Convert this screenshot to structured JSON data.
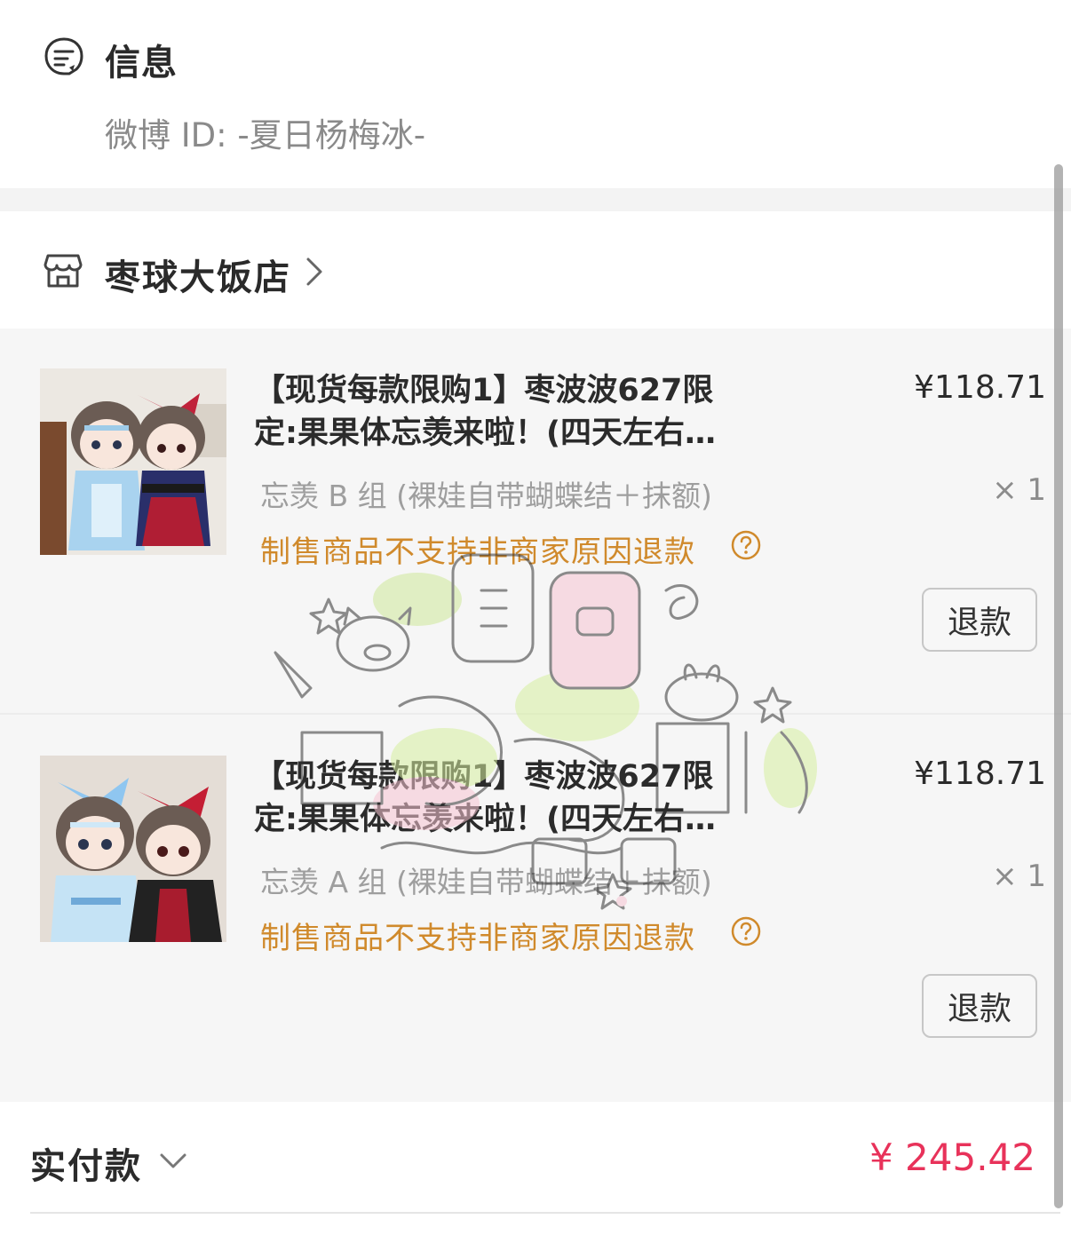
{
  "info": {
    "title": "信息",
    "weibo_id": "微博 ID: -夏日杨梅冰-"
  },
  "shop": {
    "name": "枣球大饭店"
  },
  "items": [
    {
      "title": "【现货每款限购1】枣波波627限定:果果体忘羡来啦！(四天左右...",
      "title_line1": "【现货每款限购1】枣波波627限",
      "title_line2": "定:果果体忘羡来啦！(四天左右…",
      "price": "¥118.71",
      "spec": "忘羡 B 组 (裸娃自带蝴蝶结＋抹额)",
      "qty": "× 1",
      "note": "制售商品不支持非商家原因退款",
      "refund_label": "退款"
    },
    {
      "title": "【现货每款限购1】枣波波627限定:果果体忘羡来啦！(四天左右...",
      "title_line1": "【现货每款限购1】枣波波627限",
      "title_line2": "定:果果体忘羡来啦！(四天左右…",
      "price": "¥118.71",
      "spec": "忘羡 A 组 (裸娃自带蝴蝶结＋抹额)",
      "qty": "× 1",
      "note": "制售商品不支持非商家原因退款",
      "refund_label": "退款"
    }
  ],
  "total": {
    "label": "实付款",
    "amount": "¥ 245.42"
  },
  "colors": {
    "price_red": "#e8325a",
    "note_orange": "#d08a2c",
    "background_gray": "#f6f6f6"
  },
  "icons": [
    "message-icon",
    "shop-icon",
    "chevron-right-icon",
    "help-icon",
    "chevron-down-icon"
  ]
}
